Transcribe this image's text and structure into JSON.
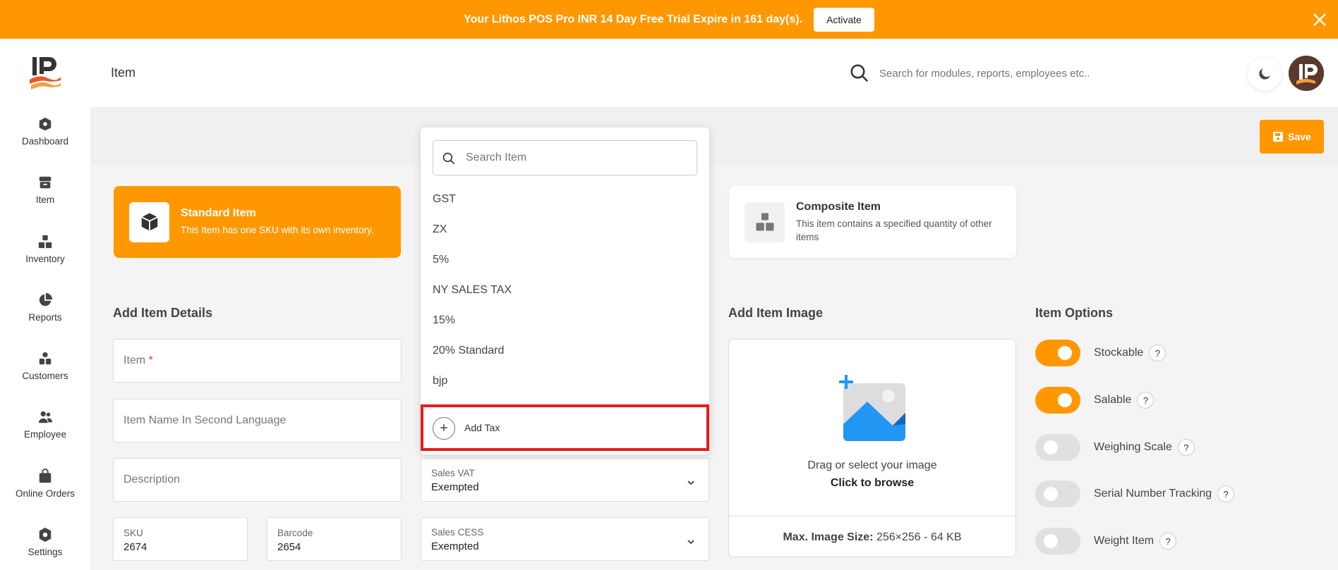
{
  "banner": {
    "text": "Your Lithos POS Pro INR 14 Day Free Trial Expire in 161 day(s).",
    "activate_label": "Activate"
  },
  "sidebar": {
    "items": [
      {
        "label": "Dashboard",
        "icon": "home-icon"
      },
      {
        "label": "Item",
        "icon": "item-box-icon"
      },
      {
        "label": "Inventory",
        "icon": "inventory-boxes-icon"
      },
      {
        "label": "Reports",
        "icon": "pie-chart-icon"
      },
      {
        "label": "Customers",
        "icon": "customers-icon"
      },
      {
        "label": "Employee",
        "icon": "employee-icon"
      },
      {
        "label": "Online Orders",
        "icon": "shopping-bag-icon"
      },
      {
        "label": "Settings",
        "icon": "settings-icon"
      }
    ]
  },
  "header": {
    "title": "Item",
    "search_placeholder": "Search for modules, reports, employees etc.."
  },
  "toolbar": {
    "save_label": "Save"
  },
  "item_types": {
    "standard": {
      "title": "Standard Item",
      "desc": "This Item has one SKU with its own inventory."
    },
    "composite": {
      "title": "Composite Item",
      "desc": "This item contains a specified quantity of other items"
    }
  },
  "details": {
    "title": "Add Item Details",
    "item_placeholder": "Item",
    "required_mark": "*",
    "second_lang_placeholder": "Item Name In Second Language",
    "description_placeholder": "Description",
    "sku_label": "SKU",
    "sku_value": "2674",
    "barcode_label": "Barcode",
    "barcode_value": "2654"
  },
  "tax_dropdown": {
    "search_placeholder": "Search Item",
    "options": [
      "GST",
      "ZX",
      "5%",
      "NY SALES TAX",
      "15%",
      "20% Standard",
      "bjp"
    ],
    "add_label": "Add Tax"
  },
  "tax_fields": {
    "sales_vat_label": "Sales VAT",
    "sales_vat_value": "Exempted",
    "sales_cess_label": "Sales CESS",
    "sales_cess_value": "Exempted"
  },
  "image": {
    "title": "Add Item Image",
    "line1": "Drag or select your image",
    "line2": "Click to browse",
    "max_label": "Max. Image Size:",
    "max_value": "256×256 - 64 KB"
  },
  "options": {
    "title": "Item Options",
    "items": [
      {
        "label": "Stockable",
        "on": true
      },
      {
        "label": "Salable",
        "on": true
      },
      {
        "label": "Weighing Scale",
        "on": false
      },
      {
        "label": "Serial Number Tracking",
        "on": false
      },
      {
        "label": "Weight Item",
        "on": false
      }
    ],
    "help": "?"
  },
  "colors": {
    "accent": "#ff9800",
    "highlight": "#e31d1d"
  }
}
